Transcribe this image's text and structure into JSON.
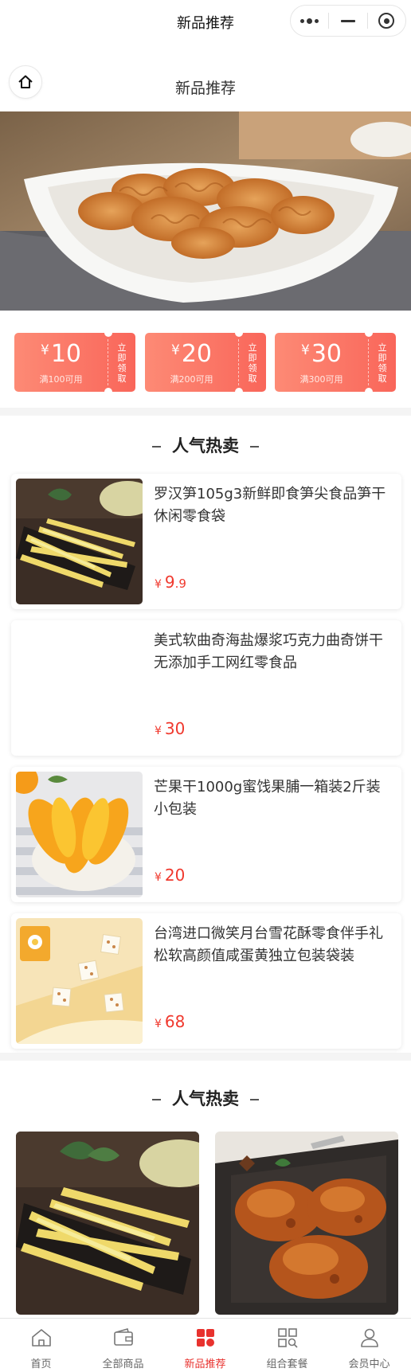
{
  "navbar": {
    "title": "新品推荐"
  },
  "header": {
    "title": "新品推荐"
  },
  "coupons": [
    {
      "currency": "¥",
      "amount": "10",
      "condition": "满100可用",
      "action": "立即领取"
    },
    {
      "currency": "¥",
      "amount": "20",
      "condition": "满200可用",
      "action": "立即领取"
    },
    {
      "currency": "¥",
      "amount": "30",
      "condition": "满300可用",
      "action": "立即领取"
    }
  ],
  "hot_list": {
    "title": "人气热卖",
    "items": [
      {
        "name": "罗汉笋105g3新鲜即食笋尖食品笋干休闲零食袋",
        "currency": "¥",
        "price_int": "9",
        "price_dec": ".9"
      },
      {
        "name": "美式软曲奇海盐爆浆巧克力曲奇饼干无添加手工网红零食品",
        "currency": "¥",
        "price_int": "30",
        "price_dec": ""
      },
      {
        "name": "芒果干1000g蜜饯果脯一箱装2斤装小包装",
        "currency": "¥",
        "price_int": "20",
        "price_dec": ""
      },
      {
        "name": "台湾进口微笑月台雪花酥零食伴手礼松软高颜值咸蛋黄独立包装袋装",
        "currency": "¥",
        "price_int": "68",
        "price_dec": ""
      }
    ]
  },
  "hot_grid": {
    "title": "人气热卖"
  },
  "tabbar": {
    "items": [
      {
        "label": "首页",
        "icon": "home-icon",
        "active": false
      },
      {
        "label": "全部商品",
        "icon": "wallet-icon",
        "active": false
      },
      {
        "label": "新品推荐",
        "icon": "grid-icon",
        "active": true
      },
      {
        "label": "组合套餐",
        "icon": "grid-search-icon",
        "active": false
      },
      {
        "label": "会员中心",
        "icon": "user-icon",
        "active": false
      }
    ],
    "active_color": "#e8322e",
    "inactive_color": "#666666"
  },
  "colors": {
    "coupon_start": "#fd8a75",
    "coupon_end": "#f9665a",
    "price": "#f0392e"
  }
}
